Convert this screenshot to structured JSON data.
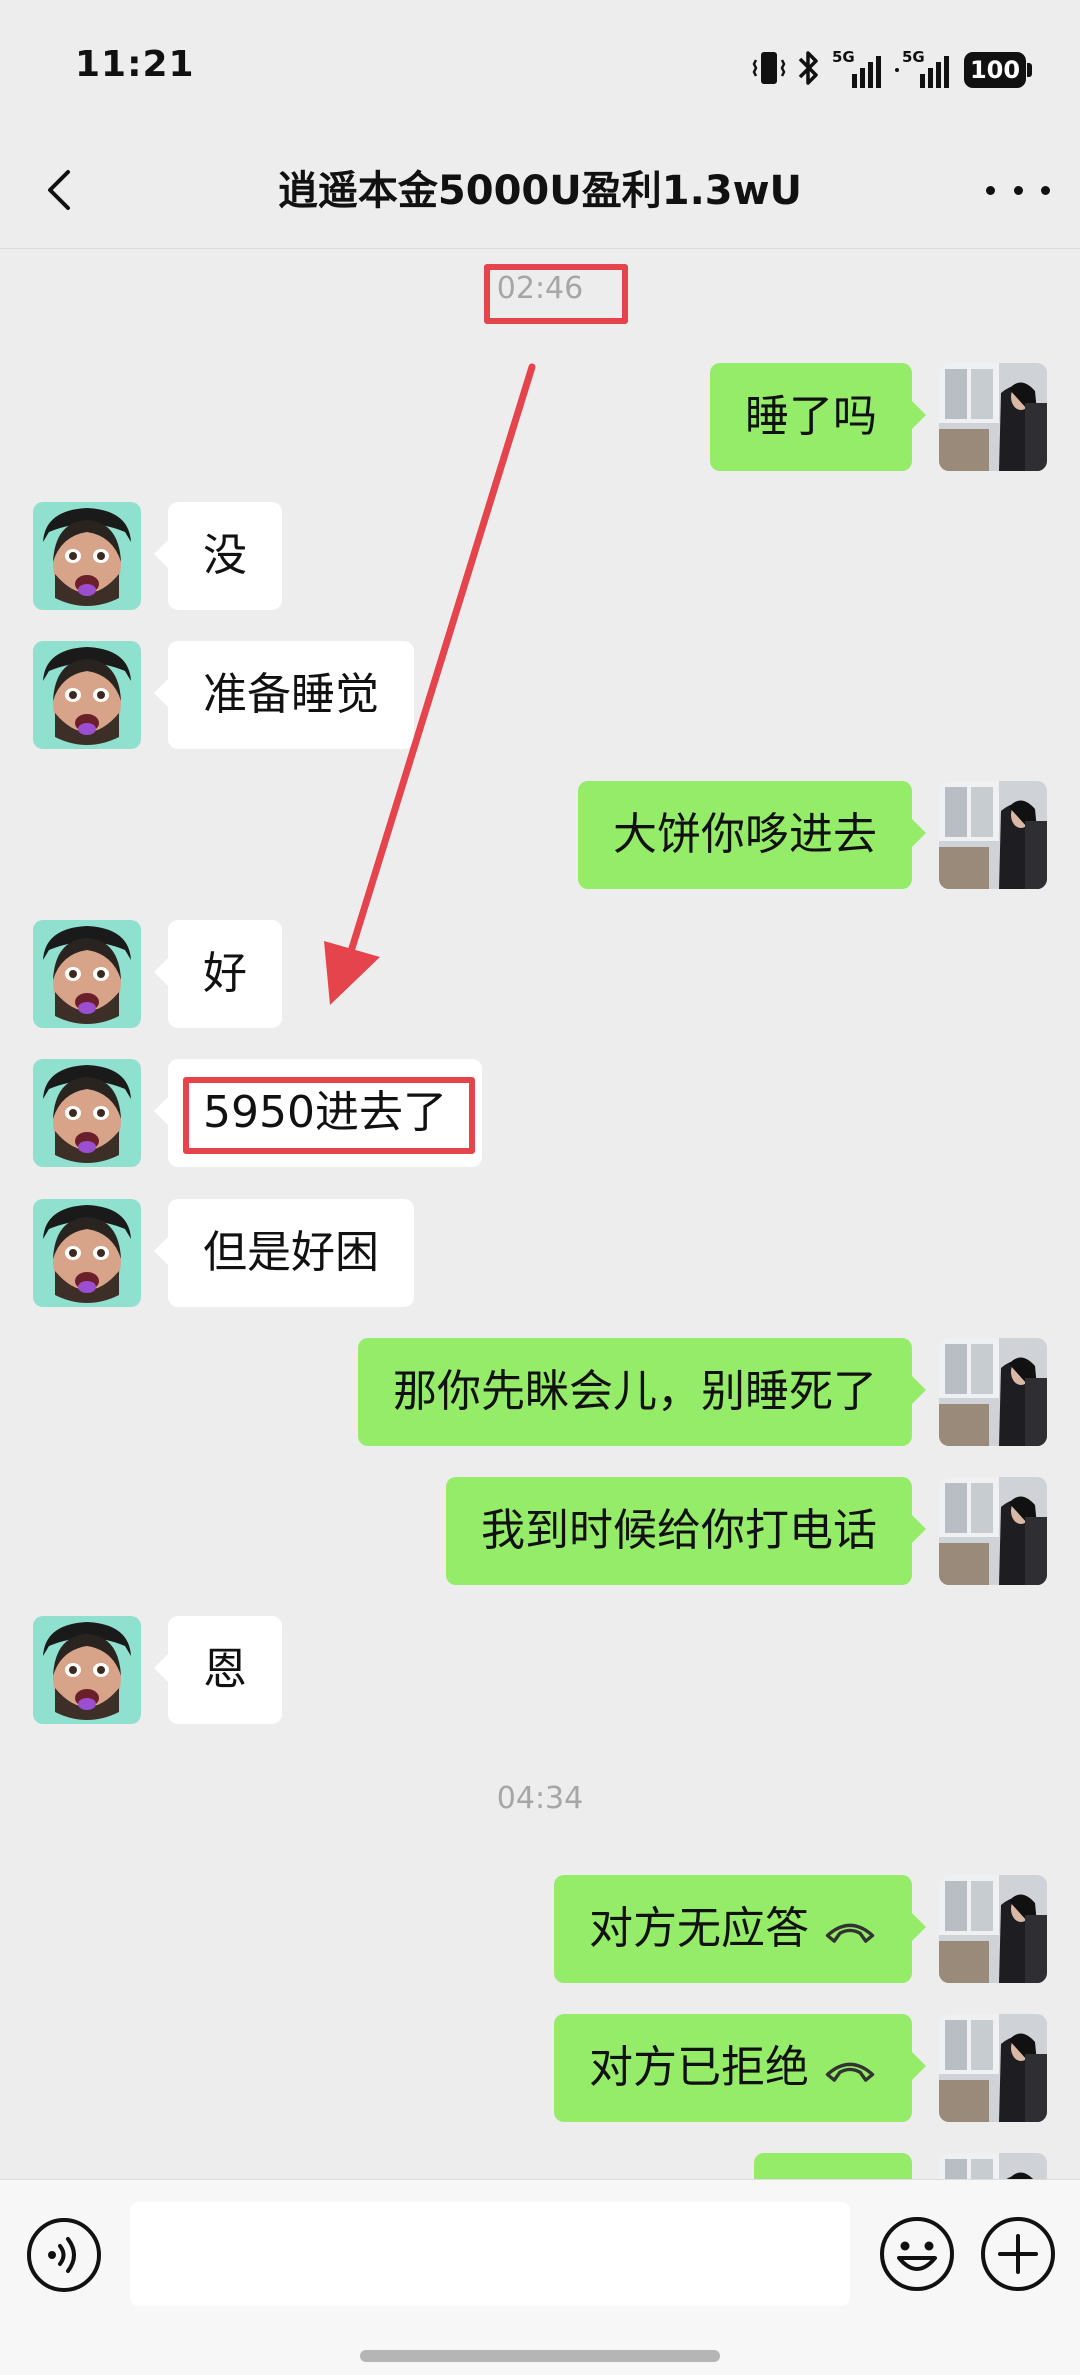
{
  "status_bar": {
    "time": "11:21",
    "signal1_label": "5G",
    "signal2_label": "5G",
    "battery": "100"
  },
  "header": {
    "title": "逍遥本金5000U盈利1.3wU"
  },
  "chat": {
    "timestamp_1": "02:46",
    "timestamp_2": "04:34",
    "messages": [
      {
        "side": "out",
        "text": "睡了吗"
      },
      {
        "side": "in",
        "text": "没"
      },
      {
        "side": "in",
        "text": "准备睡觉"
      },
      {
        "side": "out",
        "text": "大饼你哆进去"
      },
      {
        "side": "in",
        "text": "好"
      },
      {
        "side": "in",
        "text": "5950进去了"
      },
      {
        "side": "in",
        "text": "但是好困"
      },
      {
        "side": "out",
        "text": "那你先眯会儿，别睡死了"
      },
      {
        "side": "out",
        "text": "我到时候给你打电话"
      },
      {
        "side": "in",
        "text": "恩"
      },
      {
        "side": "out",
        "text": "对方无应答"
      },
      {
        "side": "out",
        "text": "对方已拒绝"
      }
    ]
  },
  "annotations": {
    "color": "#e5444c"
  },
  "input": {
    "placeholder": ""
  },
  "colors": {
    "background": "#ededed",
    "outgoing_bubble": "#95ec69",
    "incoming_bubble": "#ffffff",
    "timestamp": "#a6a6a6"
  },
  "icons": {
    "back": "chevron-left-icon",
    "more": "more-dots-icon",
    "voice": "voice-icon",
    "emoji": "emoji-icon",
    "plus": "plus-icon",
    "hangup": "phone-hangup-icon"
  }
}
